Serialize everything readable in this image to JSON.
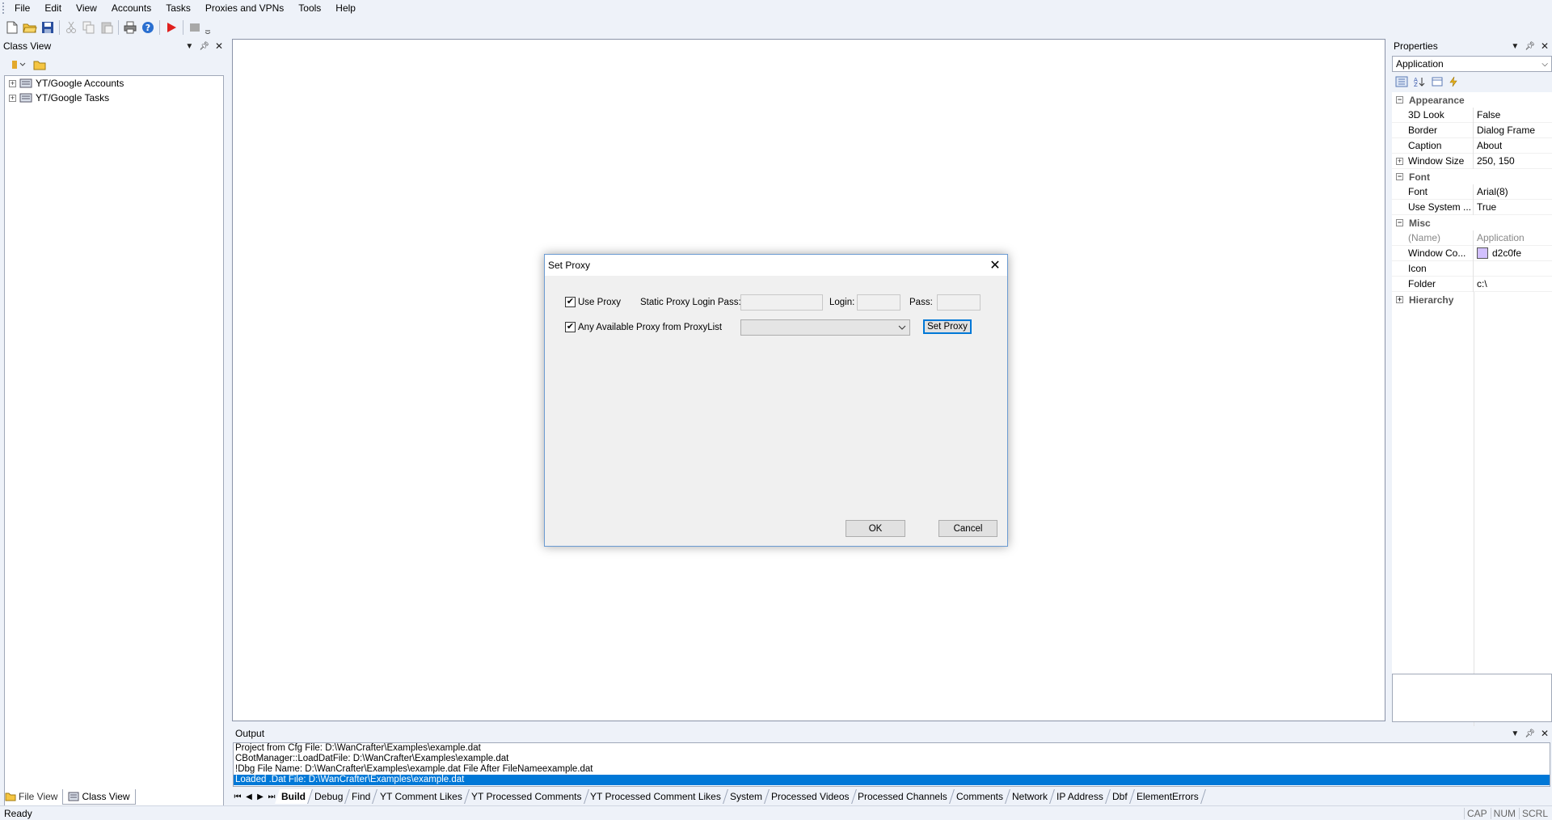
{
  "menu": [
    "File",
    "Edit",
    "View",
    "Accounts",
    "Tasks",
    "Proxies and VPNs",
    "Tools",
    "Help"
  ],
  "toolbar_icons": [
    "new-file-icon",
    "open-folder-icon",
    "save-icon",
    "cut-icon",
    "copy-icon",
    "paste-icon",
    "print-icon",
    "help-icon",
    "run-icon",
    "stop-icon"
  ],
  "classview": {
    "title": "Class View",
    "tree": [
      "YT/Google Accounts",
      "YT/Google Tasks"
    ]
  },
  "properties": {
    "title": "Properties",
    "selected": "Application",
    "categories": [
      {
        "name": "Appearance",
        "rows": [
          {
            "name": "3D Look",
            "value": "False"
          },
          {
            "name": "Border",
            "value": "Dialog Frame"
          },
          {
            "name": "Caption",
            "value": "About"
          },
          {
            "name": "Window Size",
            "value": "250, 150",
            "expandable": true
          }
        ]
      },
      {
        "name": "Font",
        "rows": [
          {
            "name": "Font",
            "value": "Arial(8)"
          },
          {
            "name": "Use System ...",
            "value": "True"
          }
        ]
      },
      {
        "name": "Misc",
        "rows": [
          {
            "name": "(Name)",
            "value": "Application",
            "grey": true
          },
          {
            "name": "Window Co...",
            "value": "d2c0fe",
            "swatch": "#d2c0fe"
          },
          {
            "name": "Icon",
            "value": ""
          },
          {
            "name": "Folder",
            "value": "c:\\"
          }
        ]
      },
      {
        "name": "Hierarchy",
        "rows": [],
        "collapsed": true
      }
    ]
  },
  "output": {
    "title": "Output",
    "lines": [
      "Project from Cfg File: D:\\WanCrafter\\Examples\\example.dat",
      "CBotManager::LoadDatFile: D:\\WanCrafter\\Examples\\example.dat",
      "!Dbg File Name: D:\\WanCrafter\\Examples\\example.dat  File After FileNameexample.dat",
      "Loaded .Dat File: D:\\WanCrafter\\Examples\\example.dat"
    ],
    "tabs": [
      "Build",
      "Debug",
      "Find",
      "YT Comment Likes",
      "YT Processed Comments",
      "YT Processed Comment Likes",
      "System",
      "Processed Videos",
      "Processed Channels",
      "Comments",
      "Network",
      "IP Address",
      "Dbf",
      "ElementErrors"
    ]
  },
  "left_tabs": [
    "File View",
    "Class View"
  ],
  "status": {
    "text": "Ready",
    "indicators": [
      "CAP",
      "NUM",
      "SCRL"
    ]
  },
  "dialog": {
    "title": "Set Proxy",
    "use_proxy_label": "Use Proxy",
    "use_proxy_checked": true,
    "static_proxy_label": "Static Proxy Login Pass:",
    "login_label": "Login:",
    "pass_label": "Pass:",
    "any_proxy_label": "Any Available Proxy from ProxyList",
    "any_proxy_checked": true,
    "set_proxy_button": "Set Proxy",
    "ok_button": "OK",
    "cancel_button": "Cancel"
  }
}
